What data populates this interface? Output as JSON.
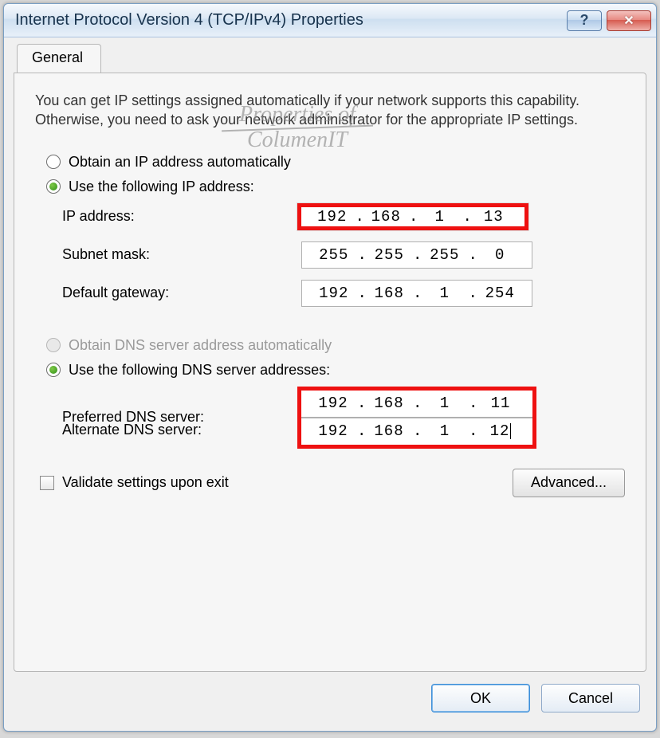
{
  "window": {
    "title": "Internet Protocol Version 4 (TCP/IPv4) Properties"
  },
  "tab": {
    "general": "General"
  },
  "description": "You can get IP settings assigned automatically if your network supports this capability. Otherwise, you need to ask your network administrator for the appropriate IP settings.",
  "watermark": {
    "line1": "Properties of",
    "line2": "ColumenIT"
  },
  "ip": {
    "auto_label": "Obtain an IP address automatically",
    "manual_label": "Use the following IP address:",
    "selected": "manual",
    "ip_label": "IP address:",
    "ip_value": {
      "o1": "192",
      "o2": "168",
      "o3": "1",
      "o4": "13"
    },
    "mask_label": "Subnet mask:",
    "mask_value": {
      "o1": "255",
      "o2": "255",
      "o3": "255",
      "o4": "0"
    },
    "gw_label": "Default gateway:",
    "gw_value": {
      "o1": "192",
      "o2": "168",
      "o3": "1",
      "o4": "254"
    }
  },
  "dns": {
    "auto_label": "Obtain DNS server address automatically",
    "auto_disabled": true,
    "manual_label": "Use the following DNS server addresses:",
    "selected": "manual",
    "pref_label": "Preferred DNS server:",
    "pref_value": {
      "o1": "192",
      "o2": "168",
      "o3": "1",
      "o4": "11"
    },
    "alt_label": "Alternate DNS server:",
    "alt_value": {
      "o1": "192",
      "o2": "168",
      "o3": "1",
      "o4": "12"
    }
  },
  "validate_label": "Validate settings upon exit",
  "validate_checked": false,
  "buttons": {
    "advanced": "Advanced...",
    "ok": "OK",
    "cancel": "Cancel"
  }
}
